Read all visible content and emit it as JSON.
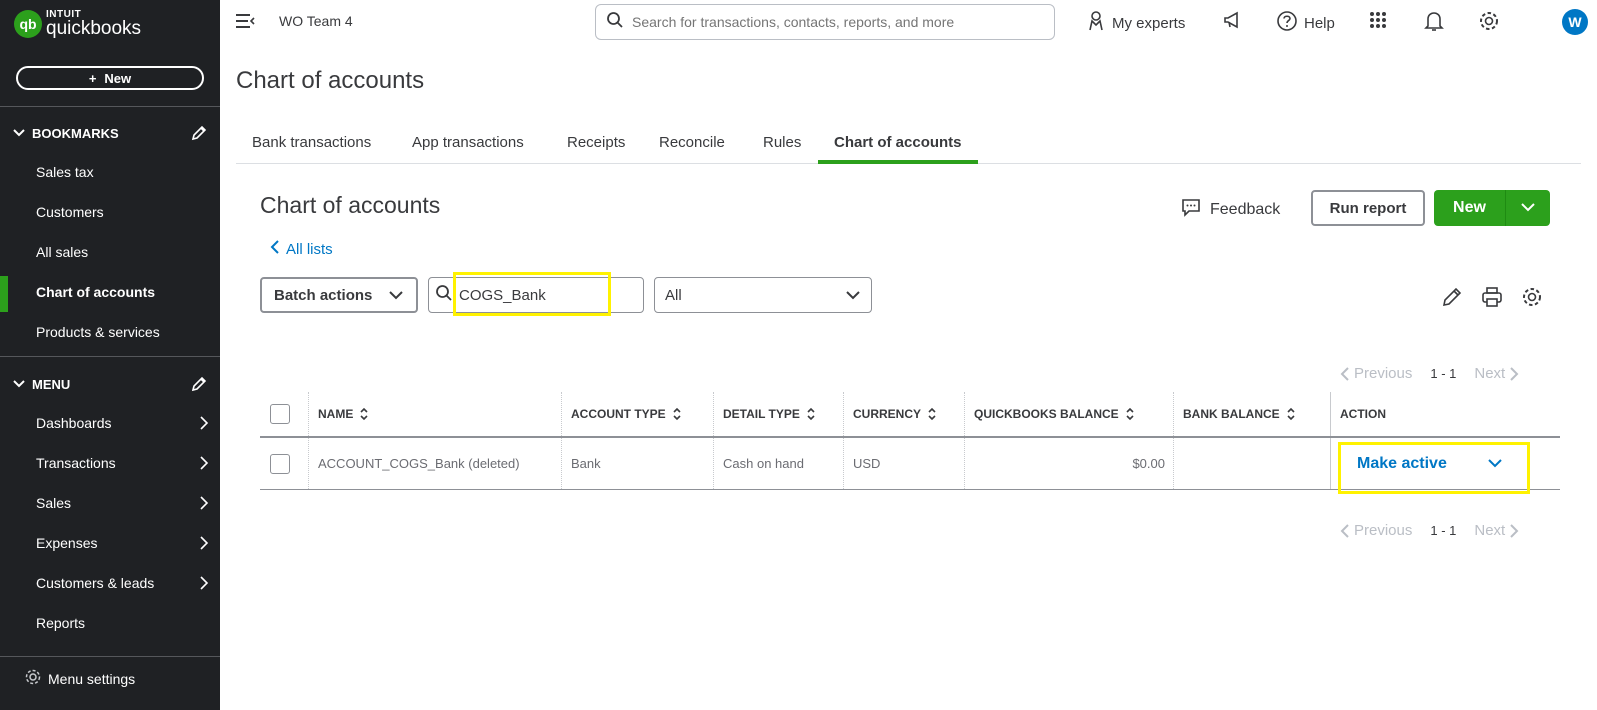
{
  "brand": {
    "intuit": "INTUIT",
    "name": "quickbooks",
    "mark": "qb"
  },
  "sidebar": {
    "new_label": "New",
    "bookmarks_header": "BOOKMARKS",
    "bookmarks": [
      {
        "label": "Sales tax"
      },
      {
        "label": "Customers"
      },
      {
        "label": "All sales"
      },
      {
        "label": "Chart of accounts",
        "active": true
      },
      {
        "label": "Products & services"
      }
    ],
    "menu_header": "MENU",
    "menu": [
      {
        "label": "Dashboards"
      },
      {
        "label": "Transactions"
      },
      {
        "label": "Sales"
      },
      {
        "label": "Expenses"
      },
      {
        "label": "Customers & leads"
      },
      {
        "label": "Reports"
      }
    ],
    "settings_label": "Menu settings"
  },
  "topbar": {
    "company": "WO Team 4",
    "search_placeholder": "Search for transactions, contacts, reports, and more",
    "my_experts": "My experts",
    "help": "Help",
    "avatar_letter": "W"
  },
  "page": {
    "title": "Chart of accounts",
    "tabs": [
      {
        "label": "Bank transactions"
      },
      {
        "label": "App transactions"
      },
      {
        "label": "Receipts"
      },
      {
        "label": "Reconcile"
      },
      {
        "label": "Rules"
      },
      {
        "label": "Chart of accounts",
        "active": true
      }
    ],
    "section_title": "Chart of accounts",
    "all_lists": "All lists",
    "feedback": "Feedback",
    "run_report": "Run report",
    "new_label": "New",
    "batch_actions": "Batch actions",
    "filter_value": "COGS_Bank",
    "type_filter": "All",
    "pager": {
      "previous": "Previous",
      "count": "1 - 1",
      "next": "Next"
    }
  },
  "table": {
    "columns": [
      "NAME",
      "ACCOUNT TYPE",
      "DETAIL TYPE",
      "CURRENCY",
      "QUICKBOOKS BALANCE",
      "BANK BALANCE",
      "ACTION"
    ],
    "rows": [
      {
        "name": "ACCOUNT_COGS_Bank (deleted)",
        "account_type": "Bank",
        "detail_type": "Cash on hand",
        "currency": "USD",
        "qb_balance": "$0.00",
        "bank_balance": "",
        "action": "Make active"
      }
    ]
  },
  "colors": {
    "brand_green": "#2ca01c",
    "link_blue": "#0077c5",
    "sidebar_bg": "#1f2124",
    "highlight": "#fff200"
  }
}
